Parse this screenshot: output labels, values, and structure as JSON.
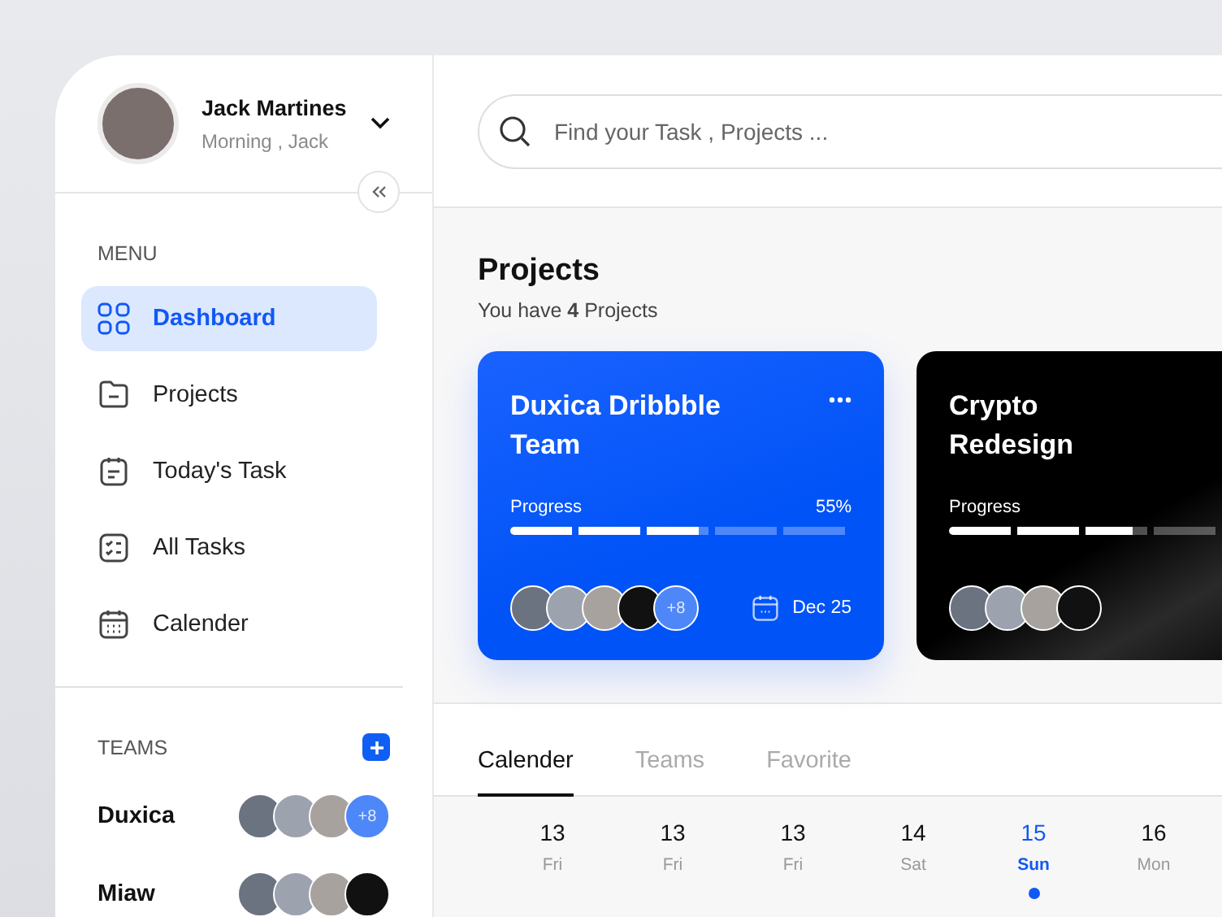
{
  "profile": {
    "name": "Jack Martines",
    "greeting": "Morning , Jack"
  },
  "menu": {
    "label": "MENU",
    "items": [
      {
        "label": "Dashboard",
        "selected": true
      },
      {
        "label": "Projects",
        "selected": false
      },
      {
        "label": "Today's Task",
        "selected": false
      },
      {
        "label": "All Tasks",
        "selected": false
      },
      {
        "label": "Calender",
        "selected": false
      }
    ]
  },
  "teams": {
    "label": "TEAMS",
    "items": [
      {
        "name": "Duxica",
        "extra": "+8"
      },
      {
        "name": "Miaw"
      }
    ]
  },
  "search": {
    "placeholder": "Find your Task , Projects ..."
  },
  "projects": {
    "title": "Projects",
    "subtitle": "You have **4** Projects",
    "cards": [
      {
        "kind": "blue",
        "title": "Duxica Dribbble Team",
        "progress_label": "Progress",
        "percent": "55%",
        "level": 0.55,
        "extra": "+8",
        "date": "Dec 25"
      },
      {
        "kind": "dark",
        "title": "Crypto Redesign",
        "progress_label": "Progress",
        "level": 0.54
      }
    ]
  },
  "tabs": [
    {
      "label": "Calender",
      "selected": true
    },
    {
      "label": "Teams",
      "selected": false
    },
    {
      "label": "Favorite",
      "selected": false
    }
  ],
  "days": [
    {
      "date": "13",
      "weekday": "Fri",
      "selected": false
    },
    {
      "date": "13",
      "weekday": "Fri",
      "selected": false
    },
    {
      "date": "13",
      "weekday": "Fri",
      "selected": false
    },
    {
      "date": "14",
      "weekday": "Sat",
      "selected": false
    },
    {
      "date": "15",
      "weekday": "Sun",
      "selected": true
    },
    {
      "date": "16",
      "weekday": "Mon",
      "selected": false
    }
  ]
}
